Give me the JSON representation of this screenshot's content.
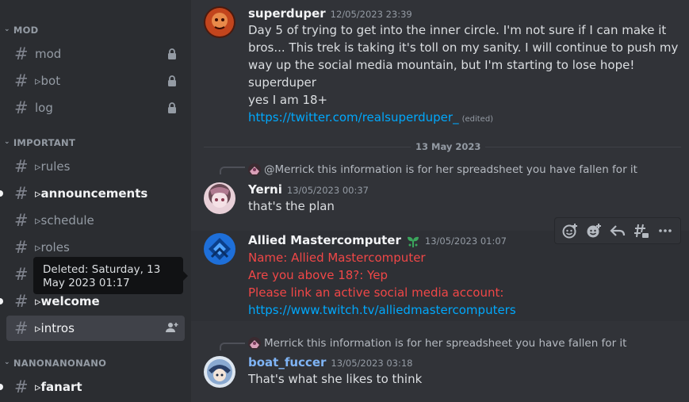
{
  "sidebar": {
    "categories": {
      "mod": "MOD",
      "important": "IMPORTANT",
      "nano": "NANONANONANO"
    },
    "channels": {
      "mod": "mod",
      "bot": "▹bot",
      "log": "log",
      "rules": "▹rules",
      "announcements": "▹announcements",
      "schedule": "▹schedule",
      "roles": "▹roles",
      "hidden": "",
      "welcome": "▹welcome",
      "intros": "▹intros",
      "fanart": "▹fanart"
    }
  },
  "tooltip": {
    "text": "Deleted: Saturday, 13 May 2023 01:17"
  },
  "messages": {
    "m1": {
      "author": "superduper",
      "timestamp": "12/05/2023 23:39",
      "lines": [
        "Day 5 of trying to get into the inner circle.  I'm not sure if I can make it",
        "bros... This trek is taking it's toll on my sanity.  I will continue to push my",
        "way up the social media mountain, but I'm starting to lose hope!",
        "superduper",
        "yes I am 18+"
      ],
      "link": "https://twitter.com/realsuperduper_",
      "edited": "(edited)"
    },
    "divider": "13 May 2023",
    "m2": {
      "reply_author": "@Merrick",
      "reply_text": "this information is for her spreadsheet you have fallen for it",
      "author": "Yerni",
      "timestamp": "13/05/2023 00:37",
      "text": "that's the plan"
    },
    "m3": {
      "author": "Allied Mastercomputer",
      "timestamp": "13/05/2023 01:07",
      "line1": "Name: Allied Mastercomputer",
      "line2": "Are you above 18?: Yep",
      "line3": "Please link an active social media account:",
      "link": "https://www.twitch.tv/alliedmastercomputers"
    },
    "m4": {
      "reply_author": "Merrick",
      "reply_text": "this information is for her spreadsheet you have fallen for it",
      "author": "boat_fuccer",
      "timestamp": "13/05/2023 03:18",
      "text": "That's what she likes to think"
    }
  },
  "colors": {
    "sidebar_bg": "#2b2d31",
    "chat_bg": "#313338",
    "link": "#00a8fc",
    "red_text": "#f04747",
    "author_blue": "#7fb4f5"
  },
  "toolbar_icons": [
    "add-reaction-icon",
    "super-reaction-icon",
    "reply-icon",
    "create-thread-icon",
    "more-icon"
  ]
}
